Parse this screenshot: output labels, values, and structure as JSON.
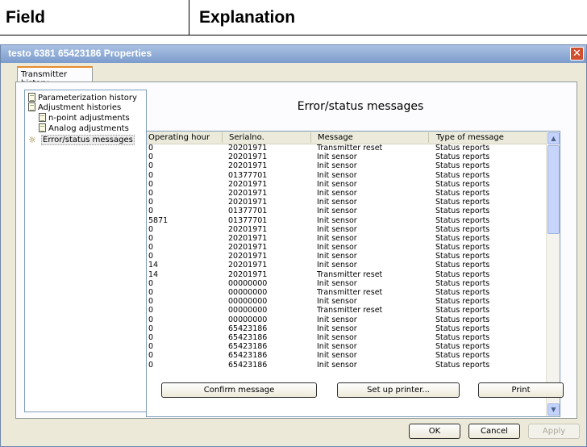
{
  "doc": {
    "col1": "Field",
    "col2": "Explanation"
  },
  "window": {
    "title": "testo 6381  65423186 Properties",
    "close_glyph": "✕"
  },
  "tab": {
    "label": "Transmitter history"
  },
  "tree": {
    "items": [
      {
        "label": "Parameterization history"
      },
      {
        "label": "Adjustment histories"
      },
      {
        "label": "n-point adjustments"
      },
      {
        "label": "Analog adjustments"
      },
      {
        "label": "Error/status messages"
      }
    ]
  },
  "main": {
    "heading": "Error/status messages"
  },
  "list": {
    "columns": [
      "Operating hour",
      "Serialno.",
      "Message",
      "Type of message"
    ],
    "rows": [
      [
        "0",
        "20201971",
        "Transmitter reset",
        "Status reports"
      ],
      [
        "0",
        "20201971",
        "Init sensor",
        "Status reports"
      ],
      [
        "0",
        "20201971",
        "Init sensor",
        "Status reports"
      ],
      [
        "0",
        "01377701",
        "Init sensor",
        "Status reports"
      ],
      [
        "0",
        "20201971",
        "Init sensor",
        "Status reports"
      ],
      [
        "0",
        "20201971",
        "Init sensor",
        "Status reports"
      ],
      [
        "0",
        "20201971",
        "Init sensor",
        "Status reports"
      ],
      [
        "0",
        "01377701",
        "Init sensor",
        "Status reports"
      ],
      [
        "5871",
        "01377701",
        "Init sensor",
        "Status reports"
      ],
      [
        "0",
        "20201971",
        "Init sensor",
        "Status reports"
      ],
      [
        "0",
        "20201971",
        "Init sensor",
        "Status reports"
      ],
      [
        "0",
        "20201971",
        "Init sensor",
        "Status reports"
      ],
      [
        "0",
        "20201971",
        "Init sensor",
        "Status reports"
      ],
      [
        "14",
        "20201971",
        "Init sensor",
        "Status reports"
      ],
      [
        "14",
        "20201971",
        "Transmitter reset",
        "Status reports"
      ],
      [
        "0",
        "00000000",
        "Init sensor",
        "Status reports"
      ],
      [
        "0",
        "00000000",
        "Transmitter reset",
        "Status reports"
      ],
      [
        "0",
        "00000000",
        "Init sensor",
        "Status reports"
      ],
      [
        "0",
        "00000000",
        "Transmitter reset",
        "Status reports"
      ],
      [
        "0",
        "00000000",
        "Init sensor",
        "Status reports"
      ],
      [
        "0",
        "65423186",
        "Init sensor",
        "Status reports"
      ],
      [
        "0",
        "65423186",
        "Init sensor",
        "Status reports"
      ],
      [
        "0",
        "65423186",
        "Init sensor",
        "Status reports"
      ],
      [
        "0",
        "65423186",
        "Init sensor",
        "Status reports"
      ],
      [
        "0",
        "65423186",
        "Init sensor",
        "Status reports"
      ]
    ]
  },
  "buttons": {
    "confirm": "Confirm message",
    "printer": "Set up printer...",
    "print": "Print",
    "ok": "OK",
    "cancel": "Cancel",
    "apply": "Apply"
  }
}
